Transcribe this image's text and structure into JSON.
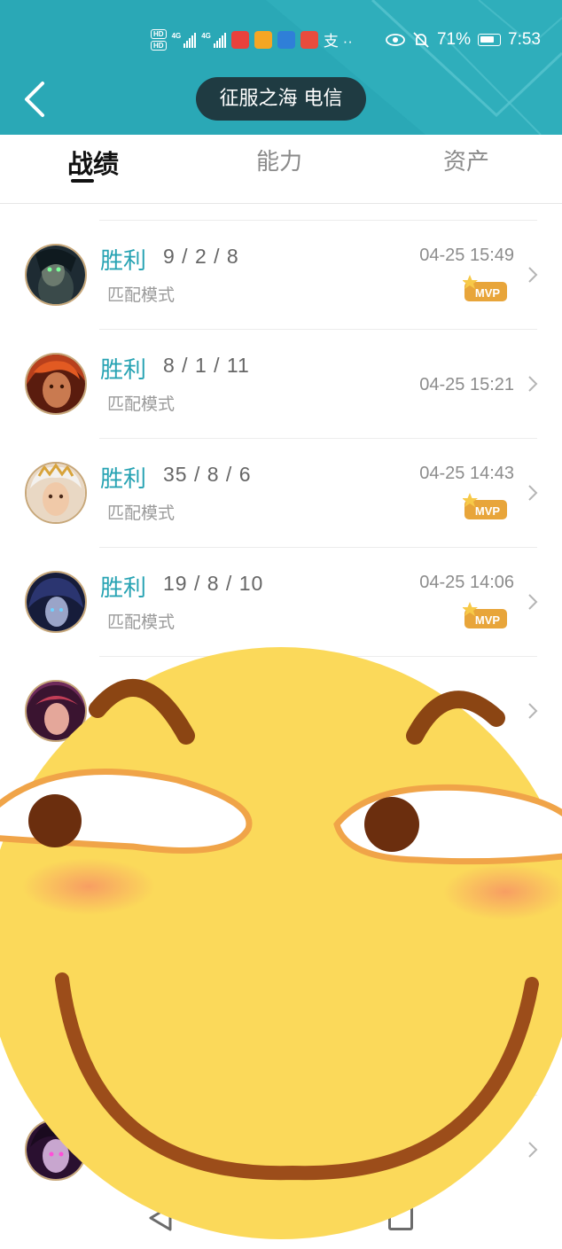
{
  "status_bar": {
    "network_1": "4G",
    "network_2": "4G",
    "battery_percent": "71%",
    "time": "7:53",
    "extra_glyph": "支 ··"
  },
  "header": {
    "title": "征服之海 电信",
    "back_icon": "chevron-left-icon",
    "accent_color": "#2aa8b6"
  },
  "tabs": [
    {
      "label": "战绩",
      "active": true
    },
    {
      "label": "能力",
      "active": false
    },
    {
      "label": "资产",
      "active": false
    }
  ],
  "matches": [
    {
      "result": "胜利",
      "kda": "9 / 2 / 8",
      "mode": "匹配模式",
      "time": "04-25 15:49",
      "mvp": true
    },
    {
      "result": "胜利",
      "kda": "8 / 1 / 11",
      "mode": "匹配模式",
      "time": "04-25 15:21",
      "mvp": false
    },
    {
      "result": "胜利",
      "kda": "35 / 8 / 6",
      "mode": "匹配模式",
      "time": "04-25 14:43",
      "mvp": true
    },
    {
      "result": "胜利",
      "kda": "19 / 8 / 10",
      "mode": "匹配模式",
      "time": "04-25 14:06",
      "mvp": true
    }
  ],
  "badge": {
    "mvp_label": "MVP"
  },
  "colors": {
    "win": "#27a3b3",
    "mvp_gold": "#e8a53a",
    "pill": "#1f3b42"
  }
}
